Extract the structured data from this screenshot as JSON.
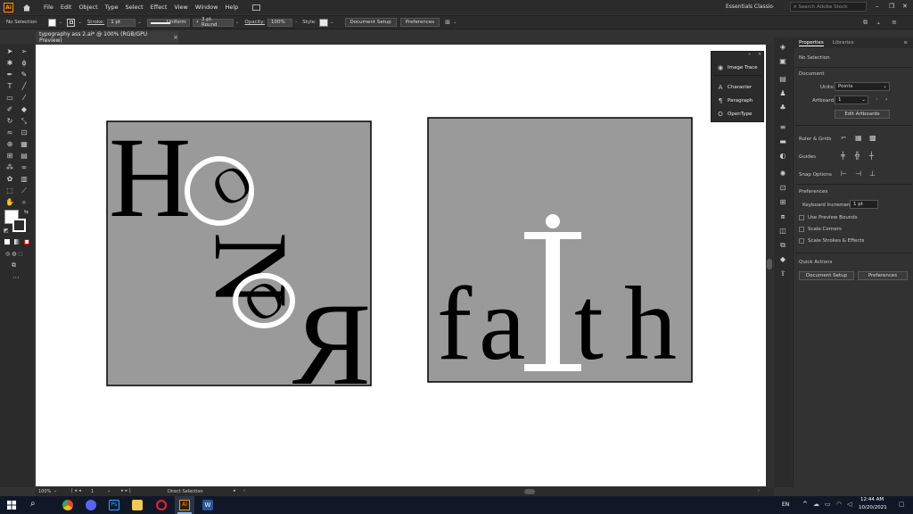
{
  "menubar": {
    "app_icon": "Ai",
    "items": [
      "File",
      "Edit",
      "Object",
      "Type",
      "Select",
      "Effect",
      "View",
      "Window",
      "Help"
    ],
    "workspace": "Essentials Classic",
    "search_placeholder": "Search Adobe Stock"
  },
  "controlbar": {
    "selection": "No Selection",
    "stroke_label": "Stroke:",
    "stroke_value": "1 pt",
    "stroke_profile": "Uniform",
    "brush": "3 pt. Round",
    "opacity_label": "Opacity:",
    "opacity_value": "100%",
    "style_label": "Style:",
    "document_setup": "Document Setup",
    "preferences": "Preferences"
  },
  "tab": {
    "title": "typography ass 2.ai* @ 100% (RGB/GPU Preview)",
    "close": "×"
  },
  "artwork": {
    "left_letters": [
      "H",
      "O",
      "N",
      "O",
      "R"
    ],
    "right_letters": [
      "f",
      "a",
      "i",
      "t",
      "h"
    ],
    "fill_color": "#9a9a9a",
    "ink_color": "#000000"
  },
  "floatpanel": {
    "items": [
      "Image Trace",
      "Character",
      "Paragraph",
      "OpenType"
    ]
  },
  "properties": {
    "tabs": [
      "Properties",
      "Libraries"
    ],
    "selection": "No Selection",
    "document_label": "Document",
    "units_label": "Units:",
    "units_value": "Points",
    "artboard_label": "Artboard:",
    "artboard_value": "1",
    "edit_artboards": "Edit Artboards",
    "rulers_grids": "Ruler & Grids",
    "guides": "Guides",
    "snap_options": "Snap Options",
    "preferences_label": "Preferences",
    "keyboard_label": "Keyboard Increment:",
    "keyboard_value": "1 pt",
    "checks": [
      "Use Preview Bounds",
      "Scale Corners",
      "Scale Strokes & Effects"
    ],
    "quick_actions": "Quick Actions",
    "qa_document_setup": "Document Setup",
    "qa_preferences": "Preferences"
  },
  "statusbar": {
    "zoom": "100%",
    "artboard": "1",
    "tool": "Direct Selection"
  },
  "taskbar": {
    "lang": "EN",
    "time": "12:44 AM",
    "date": "10/20/2021"
  }
}
